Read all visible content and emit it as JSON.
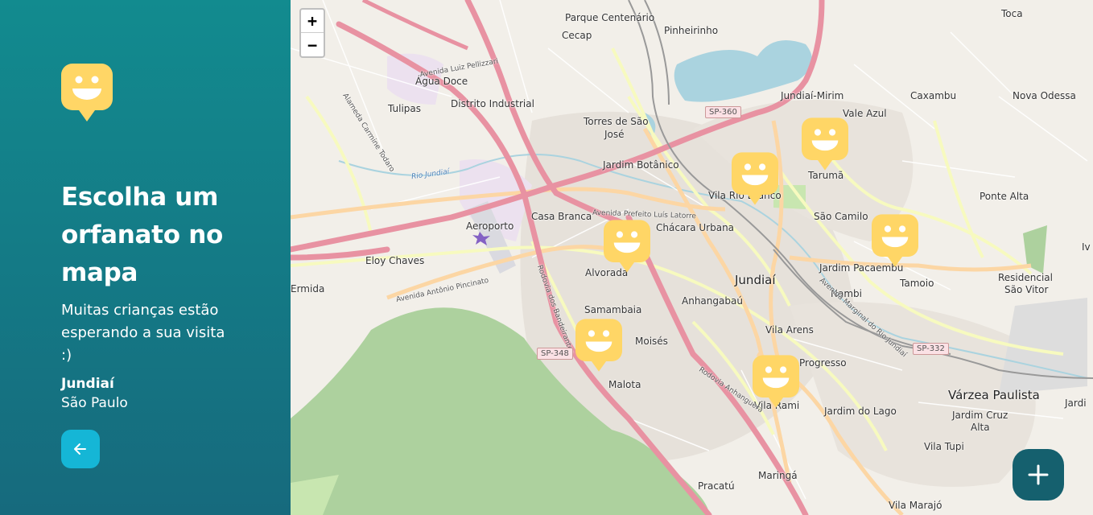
{
  "sidebar": {
    "title": "Escolha um orfanato no mapa",
    "subtitle": "Muitas crianças estão esperando a sua visita :)",
    "city": "Jundiaí",
    "state": "São Paulo",
    "back_icon": "arrow-left-icon",
    "logo_icon": "smiley-marker-icon"
  },
  "map": {
    "zoom_in": "+",
    "zoom_out": "−",
    "places": {
      "toca": "Toca",
      "parque_centenario": "Parque Centenário",
      "cecap": "Cecap",
      "pinheirinho": "Pinheirinho",
      "agua_doce": "Água Doce",
      "tulipas": "Tulipas",
      "distrito_industrial": "Distrito Industrial",
      "torres_sao_jose_1": "Torres de São",
      "torres_sao_jose_2": "José",
      "jundiai_mirim": "Jundiaí-Mirim",
      "caxambu": "Caxambu",
      "nova_odessa": "Nova Odessa",
      "vale_azul": "Vale Azul",
      "jardim_botanico": "Jardim Botânico",
      "tarumã": "Tarumã",
      "vila_rio_branco": "Vila Rio Branco",
      "ponte_alta": "Ponte Alta",
      "casa_branca": "Casa Branca",
      "sao_camilo": "São Camilo",
      "aeroporto": "Aeroporto",
      "chacara_urbana": "Chácara Urbana",
      "eloy_chaves": "Eloy Chaves",
      "vila_arens_top": "Vila Arens",
      "jardim_pacaembu": "Jardim Pacaembu",
      "tamoio": "Tamoio",
      "residencial_sao_vitor_1": "Residencial",
      "residencial_sao_vitor_2": "São Vitor",
      "ermida": "Ermida",
      "alvorada": "Alvorada",
      "jundiai": "Jundiaí",
      "anhangabau": "Anhangabaú",
      "nambi": "Nambi",
      "samambaia": "Samambaia",
      "vila_arens": "Vila Arens",
      "moises": "Moisés",
      "progresso": "Progresso",
      "malota": "Malota",
      "varzea_paulista": "Várzea Paulista",
      "vila_rami": "Vila Rami",
      "jardim_do_lago": "Jardim do Lago",
      "jardim_cruz_alta_1": "Jardim Cruz",
      "jardim_cruz_alta_2": "Alta",
      "vila_tupi": "Vila Tupi",
      "pracatu": "Pracatú",
      "maringa": "Maringá",
      "vila_marajo": "Vila Marajó",
      "jardi": "Jardi",
      "iv": "Iv",
      "sp360": "SP-360",
      "sp348": "SP-348",
      "sp332": "SP-332",
      "rio_jundiai": "Rio Jundiaí",
      "rodovia_anhanguera": "Rodovia Anhanguera",
      "rodovia_bandeirantes": "Rodovia dos Bandeirantes",
      "av_antonio_pincinato": "Avenida Antônio Pincinato",
      "av_luiz_pellizzari": "Avenida Luiz Pellizzari",
      "alameda_carmine": "Alameda Carmine Todaro",
      "av_prefeito": "Avenida Prefeito Luís Latorre",
      "av_marginal": "Avenida Marginal do Rio Jundiaí"
    },
    "markers": [
      {
        "name": "orphanage-marker-1",
        "icon": "smiley-marker-icon"
      },
      {
        "name": "orphanage-marker-2",
        "icon": "smiley-marker-icon"
      },
      {
        "name": "orphanage-marker-3",
        "icon": "smiley-marker-icon"
      },
      {
        "name": "orphanage-marker-4",
        "icon": "smiley-marker-icon"
      },
      {
        "name": "orphanage-marker-5",
        "icon": "smiley-marker-icon"
      },
      {
        "name": "orphanage-marker-6",
        "icon": "smiley-marker-icon"
      }
    ]
  },
  "add_button": {
    "icon": "plus-icon"
  },
  "colors": {
    "sidebar_start": "#128b8f",
    "sidebar_end": "#166a7d",
    "marker_yellow": "#ffd666",
    "back_button": "#15b6d6",
    "add_button": "#15606e"
  }
}
